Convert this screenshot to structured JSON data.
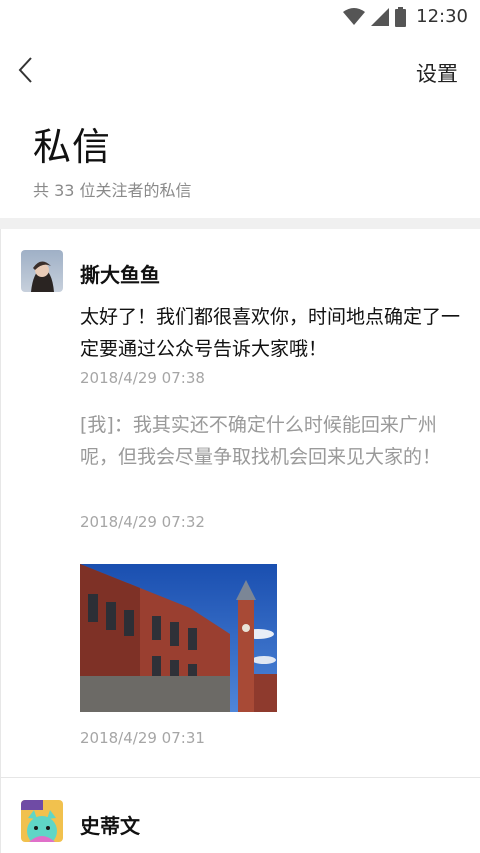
{
  "status": {
    "time": "12:30"
  },
  "header": {
    "settings_label": "设置"
  },
  "page": {
    "title": "私信",
    "subtitle": "共 33 位关注者的私信"
  },
  "conversations": [
    {
      "name": "撕大鱼鱼",
      "messages": [
        {
          "text": "太好了！我们都很喜欢你，时间地点确定了一定要通过公众号告诉大家哦！",
          "time": "2018/4/29  07:38"
        },
        {
          "text": "[我]：我其实还不确定什么时候能回来广州呢，但我会尽量争取找机会回来见大家的！",
          "time": "2018/4/29  07:32"
        },
        {
          "time": "2018/4/29  07:31"
        }
      ]
    },
    {
      "name": "史蒂文"
    }
  ]
}
